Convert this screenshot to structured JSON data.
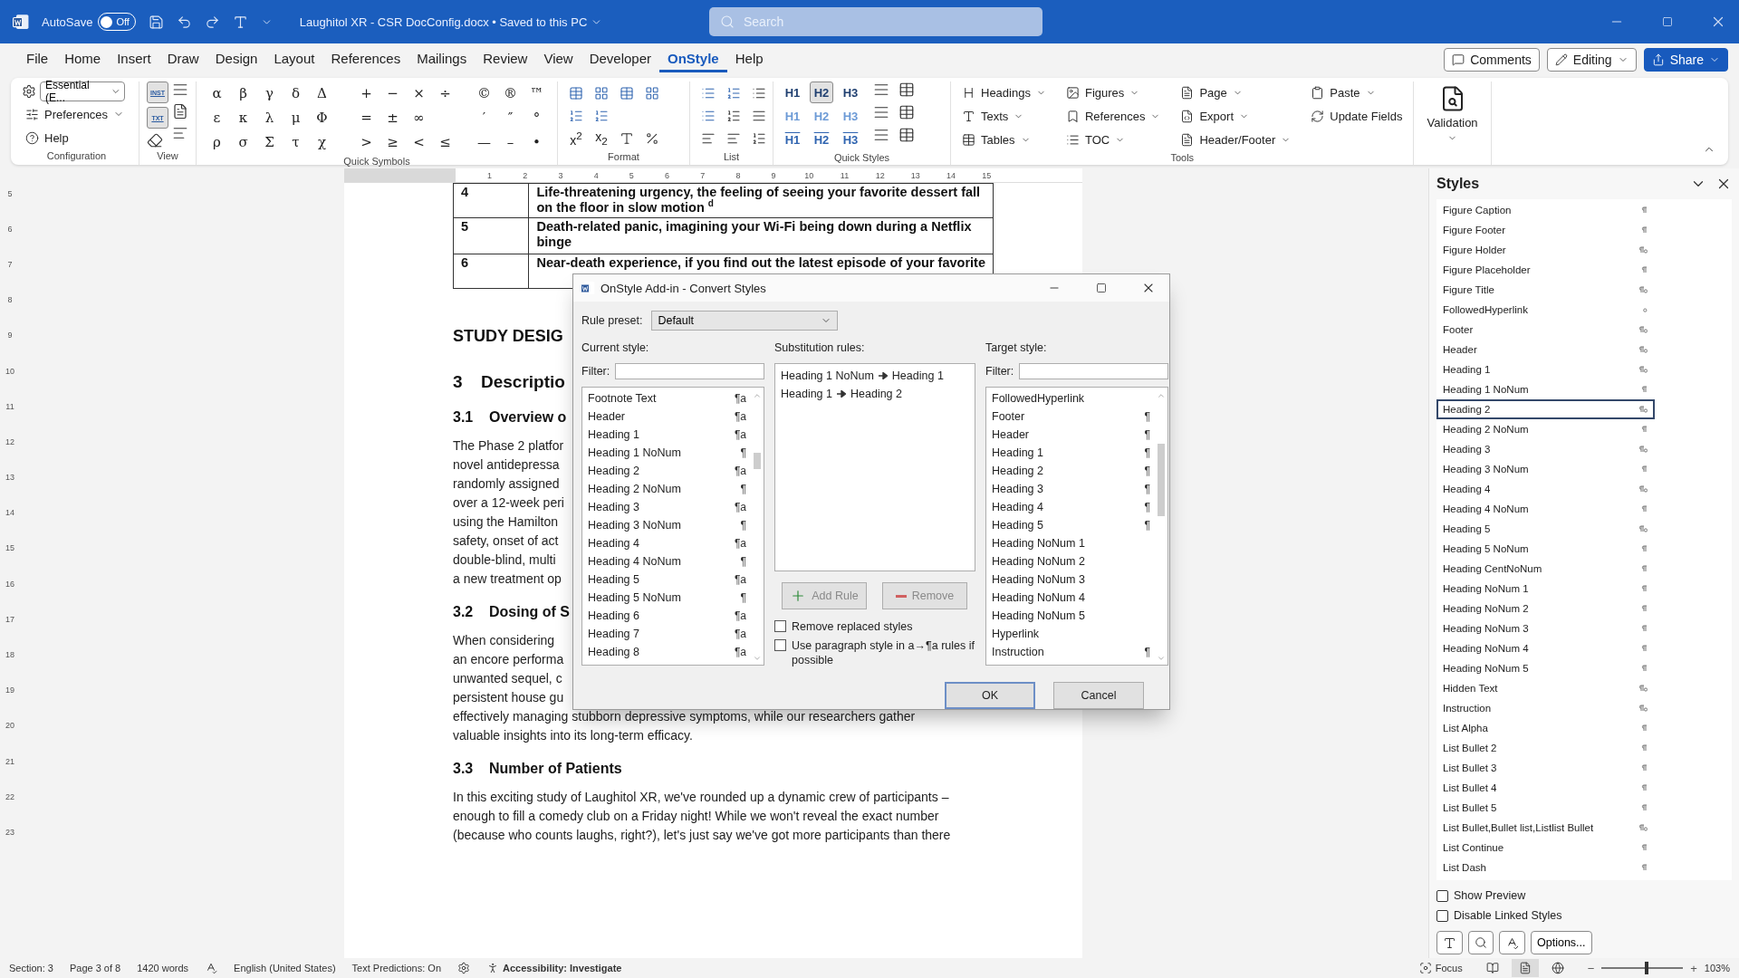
{
  "title_bar": {
    "autosave_label": "AutoSave",
    "autosave": {
      "on": false,
      "label": "Off"
    },
    "document_title": "Laughitol XR - CSR DocConfig.docx • Saved to this PC",
    "search": {
      "placeholder": "Search"
    }
  },
  "menu_tabs": [
    {
      "label": "File",
      "selected": false
    },
    {
      "label": "Home",
      "selected": false
    },
    {
      "label": "Insert",
      "selected": false
    },
    {
      "label": "Draw",
      "selected": false
    },
    {
      "label": "Design",
      "selected": false
    },
    {
      "label": "Layout",
      "selected": false
    },
    {
      "label": "References",
      "selected": false
    },
    {
      "label": "Mailings",
      "selected": false
    },
    {
      "label": "Review",
      "selected": false
    },
    {
      "label": "View",
      "selected": false
    },
    {
      "label": "Developer",
      "selected": false
    },
    {
      "label": "OnStyle",
      "selected": true
    },
    {
      "label": "Help",
      "selected": false
    }
  ],
  "menu_actions": [
    {
      "label": "Comments",
      "kind": "comments"
    },
    {
      "label": "Editing",
      "kind": "editing"
    },
    {
      "label": "Share",
      "kind": "share"
    }
  ],
  "ribbon": {
    "configuration": {
      "label": "Configuration",
      "preset": "Essential (E...",
      "preferences": "Preferences",
      "help": "Help"
    },
    "view": {
      "label": "View",
      "buttons": [
        {
          "label": "INST",
          "selected": true
        },
        {
          "label": "TXT",
          "selected": true
        }
      ]
    },
    "quick_symbols": {
      "label": "Quick Symbols",
      "sets": [
        {
          "kind": "greek",
          "rows": [
            [
              "α",
              "β",
              "γ",
              "δ",
              "Δ"
            ],
            [
              "ε",
              "κ",
              "λ",
              "μ",
              "Φ"
            ],
            [
              "ρ",
              "σ",
              "Σ",
              "τ",
              "χ"
            ]
          ]
        },
        {
          "kind": "math",
          "rows": [
            [
              "+",
              "−",
              "×",
              "÷"
            ],
            [
              "=",
              "±",
              "∞"
            ],
            [
              ">",
              "≥",
              "<",
              "≤"
            ]
          ]
        },
        {
          "kind": "marks",
          "rows": [
            [
              "©",
              "®",
              "™"
            ],
            [
              "′",
              "″",
              "°"
            ],
            [
              "—",
              "–",
              "•"
            ]
          ]
        }
      ]
    },
    "format": {
      "label": "Format",
      "superscript": "x$^{2}$",
      "subscript": "x$_{2}$"
    },
    "list": {
      "label": "List"
    },
    "quick_styles": {
      "label": "Quick Styles",
      "items": [
        {
          "label": "H1",
          "kind": "solid",
          "selected": false
        },
        {
          "label": "H2",
          "kind": "solid",
          "selected": true
        },
        {
          "label": "H3",
          "kind": "solid",
          "selected": false
        },
        {
          "label": "H1",
          "kind": "outline",
          "selected": false
        },
        {
          "label": "H2",
          "kind": "outline",
          "selected": false
        },
        {
          "label": "H3",
          "kind": "outline",
          "selected": false
        },
        {
          "label": "H1",
          "kind": "numbered",
          "selected": false
        },
        {
          "label": "H2",
          "kind": "numbered",
          "selected": false
        },
        {
          "label": "H3",
          "kind": "numbered",
          "selected": false
        }
      ]
    },
    "tools": {
      "label": "Tools",
      "columns": [
        [
          {
            "label": "Headings",
            "kind": "headings",
            "dropdown": true
          },
          {
            "label": "Texts",
            "kind": "texts",
            "dropdown": true
          },
          {
            "label": "Tables",
            "kind": "tables",
            "dropdown": true
          }
        ],
        [
          {
            "label": "Figures",
            "kind": "figures",
            "dropdown": true
          },
          {
            "label": "References",
            "kind": "references",
            "dropdown": true
          },
          {
            "label": "TOC",
            "kind": "toc",
            "dropdown": true
          }
        ],
        [
          {
            "label": "Page",
            "kind": "page",
            "dropdown": true
          },
          {
            "label": "Export",
            "kind": "export",
            "dropdown": true
          },
          {
            "label": "Header/Footer",
            "kind": "header_footer",
            "dropdown": true
          }
        ],
        [
          {
            "label": "Paste",
            "kind": "paste",
            "dropdown": true
          },
          {
            "label": "Update Fields",
            "kind": "update_fields",
            "dropdown": false
          }
        ]
      ]
    },
    "validation": {
      "label": "Validation"
    }
  },
  "ruler": {
    "horizontal": [
      "1",
      "2",
      "3",
      "4",
      "5",
      "6",
      "7",
      "8",
      "9",
      "10",
      "11",
      "12",
      "13",
      "14",
      "15"
    ],
    "vertical": [
      "5",
      "6",
      "7",
      "8",
      "9",
      "10",
      "11",
      "12",
      "13",
      "14",
      "15",
      "16",
      "17",
      "18",
      "19",
      "20",
      "21",
      "22",
      "23"
    ]
  },
  "document": {
    "table_rows": [
      {
        "number": "4",
        "lines": [
          "Life-threatening urgency, the feeling of seeing your favorite dessert fall",
          "on the floor in slow motion $^{d}$"
        ]
      },
      {
        "number": "5",
        "lines": [
          "Death-related panic, imagining your Wi-Fi being down during a Netflix",
          "binge"
        ]
      },
      {
        "number": "6",
        "lines": [
          "Near-death experience, if you find out the latest episode of your favorite"
        ]
      }
    ],
    "blocks": [
      {
        "kind": "title",
        "text": "STUDY DESIG"
      },
      {
        "kind": "h1",
        "number": "3",
        "text": "Descriptio"
      },
      {
        "kind": "h2",
        "number": "3.1",
        "text": "Overview o"
      },
      {
        "kind": "para",
        "lines": [
          "The Phase 2 platfor",
          "novel antidepressa",
          "randomly assigned",
          "over a 12-week peri",
          "using the Hamilton",
          "safety, onset of act",
          "double-blind, multi",
          "a new treatment op"
        ]
      },
      {
        "kind": "h2",
        "number": "3.2",
        "text": "Dosing of S"
      },
      {
        "kind": "para",
        "lines": [
          "When considering",
          "an encore performa",
          "unwanted sequel, c",
          "persistent house gu",
          "effectively managing stubborn depressive symptoms, while our researchers gather",
          "valuable insights into its long-term efficacy."
        ]
      },
      {
        "kind": "h2",
        "number": "3.3",
        "text": "Number of Patients"
      },
      {
        "kind": "para",
        "lines": [
          "In this exciting study of Laughitol XR, we've rounded up a dynamic crew of participants –",
          "enough to fill a comedy club on a Friday night! While we won't reveal the exact number",
          "(because who counts laughs, right?), let's just say we've got more participants than there"
        ]
      }
    ]
  },
  "dialog": {
    "title": "OnStyle Add-in - Convert Styles",
    "rule_preset": {
      "label": "Rule preset:",
      "value": "Default"
    },
    "current": {
      "label": "Current style:",
      "filter_label": "Filter:",
      "items": [
        {
          "name": "Footnote Text",
          "mark": "¶a"
        },
        {
          "name": "Header",
          "mark": "¶a"
        },
        {
          "name": "Heading 1",
          "mark": "¶a"
        },
        {
          "name": "Heading 1 NoNum",
          "mark": "¶"
        },
        {
          "name": "Heading 2",
          "mark": "¶a"
        },
        {
          "name": "Heading 2 NoNum",
          "mark": "¶"
        },
        {
          "name": "Heading 3",
          "mark": "¶a"
        },
        {
          "name": "Heading 3 NoNum",
          "mark": "¶"
        },
        {
          "name": "Heading 4",
          "mark": "¶a"
        },
        {
          "name": "Heading 4 NoNum",
          "mark": "¶"
        },
        {
          "name": "Heading 5",
          "mark": "¶a"
        },
        {
          "name": "Heading 5 NoNum",
          "mark": "¶"
        },
        {
          "name": "Heading 6",
          "mark": "¶a"
        },
        {
          "name": "Heading 7",
          "mark": "¶a"
        },
        {
          "name": "Heading 8",
          "mark": "¶a"
        }
      ]
    },
    "substitution": {
      "label": "Substitution rules:",
      "rules": [
        {
          "from": "Heading 1 NoNum",
          "to": "Heading 1"
        },
        {
          "from": "Heading 1",
          "to": "Heading 2"
        }
      ]
    },
    "buttons": [
      {
        "label": "Add Rule",
        "kind": "add",
        "disabled": true
      },
      {
        "label": "Remove",
        "kind": "remove",
        "disabled": true
      }
    ],
    "options": [
      {
        "label": "Remove replaced styles",
        "checked": false
      },
      {
        "label": "Use paragraph style in a→¶a rules if possible",
        "checked": false
      }
    ],
    "target": {
      "label": "Target style:",
      "filter_label": "Filter:",
      "items": [
        {
          "name": "FollowedHyperlink"
        },
        {
          "name": "Footer",
          "mark": "¶"
        },
        {
          "name": "Header",
          "mark": "¶"
        },
        {
          "name": "Heading 1",
          "mark": "¶"
        },
        {
          "name": "Heading 2",
          "mark": "¶"
        },
        {
          "name": "Heading 3",
          "mark": "¶"
        },
        {
          "name": "Heading 4",
          "mark": "¶"
        },
        {
          "name": "Heading 5",
          "mark": "¶"
        },
        {
          "name": "Heading NoNum 1"
        },
        {
          "name": "Heading NoNum 2"
        },
        {
          "name": "Heading NoNum 3"
        },
        {
          "name": "Heading NoNum 4"
        },
        {
          "name": "Heading NoNum 5"
        },
        {
          "name": "Hyperlink"
        },
        {
          "name": "Instruction",
          "mark": "¶"
        }
      ]
    },
    "actions": [
      {
        "label": "OK",
        "kind": "default"
      },
      {
        "label": "Cancel",
        "kind": "normal"
      }
    ]
  },
  "styles_pane": {
    "title": "Styles",
    "items": [
      {
        "name": "Figure Caption",
        "kind": "paragraph",
        "selected": false
      },
      {
        "name": "Figure Footer",
        "kind": "paragraph",
        "selected": false
      },
      {
        "name": "Figure Holder",
        "kind": "linked",
        "selected": false
      },
      {
        "name": "Figure Placeholder",
        "kind": "paragraph",
        "selected": false
      },
      {
        "name": "Figure Title",
        "kind": "linked",
        "selected": false
      },
      {
        "name": "FollowedHyperlink",
        "kind": "character",
        "selected": false
      },
      {
        "name": "Footer",
        "kind": "linked",
        "selected": false
      },
      {
        "name": "Header",
        "kind": "linked",
        "selected": false
      },
      {
        "name": "Heading 1",
        "kind": "linked",
        "selected": false
      },
      {
        "name": "Heading 1 NoNum",
        "kind": "paragraph",
        "selected": false
      },
      {
        "name": "Heading 2",
        "kind": "linked",
        "selected": true
      },
      {
        "name": "Heading 2 NoNum",
        "kind": "paragraph",
        "selected": false
      },
      {
        "name": "Heading 3",
        "kind": "linked",
        "selected": false
      },
      {
        "name": "Heading 3 NoNum",
        "kind": "paragraph",
        "selected": false
      },
      {
        "name": "Heading 4",
        "kind": "linked",
        "selected": false
      },
      {
        "name": "Heading 4 NoNum",
        "kind": "paragraph",
        "selected": false
      },
      {
        "name": "Heading 5",
        "kind": "linked",
        "selected": false
      },
      {
        "name": "Heading 5 NoNum",
        "kind": "paragraph",
        "selected": false
      },
      {
        "name": "Heading CentNoNum",
        "kind": "paragraph",
        "selected": false
      },
      {
        "name": "Heading NoNum 1",
        "kind": "paragraph",
        "selected": false
      },
      {
        "name": "Heading NoNum 2",
        "kind": "paragraph",
        "selected": false
      },
      {
        "name": "Heading NoNum 3",
        "kind": "paragraph",
        "selected": false
      },
      {
        "name": "Heading NoNum 4",
        "kind": "paragraph",
        "selected": false
      },
      {
        "name": "Heading NoNum 5",
        "kind": "paragraph",
        "selected": false
      },
      {
        "name": "Hidden Text",
        "kind": "linked",
        "selected": false
      },
      {
        "name": "Instruction",
        "kind": "linked",
        "selected": false
      },
      {
        "name": "List Alpha",
        "kind": "paragraph",
        "selected": false
      },
      {
        "name": "List Bullet 2",
        "kind": "paragraph",
        "selected": false
      },
      {
        "name": "List Bullet 3",
        "kind": "paragraph",
        "selected": false
      },
      {
        "name": "List Bullet 4",
        "kind": "paragraph",
        "selected": false
      },
      {
        "name": "List Bullet 5",
        "kind": "paragraph",
        "selected": false
      },
      {
        "name": "List Bullet,Bullet list,Listlist Bullet",
        "kind": "linked",
        "selected": false
      },
      {
        "name": "List Continue",
        "kind": "paragraph",
        "selected": false
      },
      {
        "name": "List Dash",
        "kind": "paragraph",
        "selected": false
      }
    ],
    "options": [
      {
        "label": "Show Preview",
        "checked": false
      },
      {
        "label": "Disable Linked Styles",
        "checked": false
      }
    ],
    "options_button": "Options..."
  },
  "status_bar": {
    "items": [
      {
        "kind": "text",
        "text": "Section: 3"
      },
      {
        "kind": "text",
        "text": "Page 3 of 8"
      },
      {
        "kind": "text",
        "text": "1420 words"
      },
      {
        "kind": "proofing"
      },
      {
        "kind": "text",
        "text": "English (United States)"
      },
      {
        "kind": "text",
        "text": "Text Predictions: On"
      },
      {
        "kind": "macro"
      },
      {
        "kind": "accessibility",
        "text": "Accessibility: Investigate"
      }
    ],
    "focus": "Focus",
    "views": [
      {
        "kind": "read",
        "selected": false
      },
      {
        "kind": "print",
        "selected": true
      },
      {
        "kind": "web",
        "selected": false
      }
    ],
    "zoom_out": "−",
    "zoom_in": "+",
    "zoom": {
      "level": 0.55,
      "reading": "103%"
    }
  }
}
